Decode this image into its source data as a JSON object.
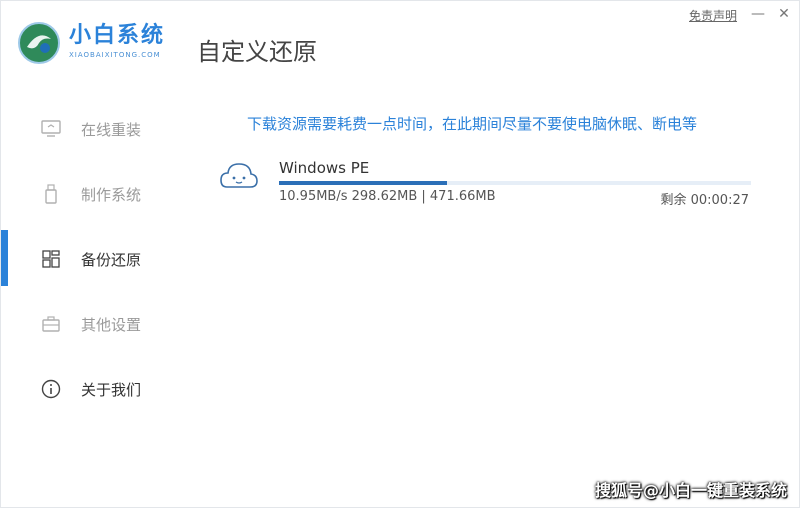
{
  "header": {
    "brand_name": "小白系统",
    "brand_sub": "XIAOBAIXITONG.COM",
    "page_title": "自定义还原",
    "disclaimer": "免责声明",
    "minimize": "—",
    "close": "✕"
  },
  "sidebar": {
    "items": [
      {
        "label": "在线重装",
        "icon": "monitor-icon"
      },
      {
        "label": "制作系统",
        "icon": "usb-icon"
      },
      {
        "label": "备份还原",
        "icon": "grid-icon"
      },
      {
        "label": "其他设置",
        "icon": "briefcase-icon"
      },
      {
        "label": "关于我们",
        "icon": "info-icon"
      }
    ],
    "active_index": 2
  },
  "main": {
    "notice": "下载资源需要耗费一点时间，在此期间尽量不要使电脑休眠、断电等",
    "download": {
      "name": "Windows PE",
      "stats": "10.95MB/s 298.62MB | 471.66MB",
      "remaining": "剩余 00:00:27",
      "progress": 0.3566
    }
  },
  "watermark": "搜狐号@小白一键重装系统",
  "colors": {
    "accent": "#2b82d9",
    "progress_fill": "#2b6fb8",
    "progress_track": "#e6eef7"
  }
}
